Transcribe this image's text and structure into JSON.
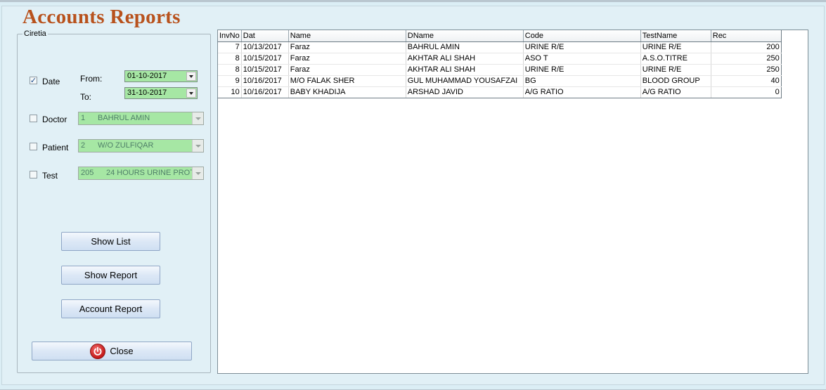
{
  "window": {
    "title": "Accounts Reports"
  },
  "criteria": {
    "legend": "Ciretia",
    "date": {
      "checked": true,
      "label": "Date",
      "from_label": "From:",
      "from_value": "01-10-2017",
      "to_label": "To:",
      "to_value": "31-10-2017"
    },
    "doctor": {
      "checked": false,
      "label": "Doctor",
      "code": "1",
      "value": "BAHRUL AMIN"
    },
    "patient": {
      "checked": false,
      "label": "Patient",
      "code": "2",
      "value": "W/O ZULFIQAR"
    },
    "test": {
      "checked": false,
      "label": "Test",
      "code": "205",
      "value": "24 HOURS URINE PROT"
    }
  },
  "buttons": {
    "show_list": "Show List",
    "show_report": "Show Report",
    "account_report": "Account Report",
    "close": "Close"
  },
  "grid": {
    "columns": [
      "InvNo",
      "Dat",
      "Name",
      "DName",
      "Code",
      "TestName",
      "Rec"
    ],
    "rows": [
      [
        "7",
        "10/13/2017",
        "Faraz",
        "BAHRUL AMIN",
        "URINE R/E",
        "URINE R/E",
        "200"
      ],
      [
        "8",
        "10/15/2017",
        "Faraz",
        "AKHTAR ALI SHAH",
        "ASO T",
        "A.S.O.TITRE",
        "250"
      ],
      [
        "8",
        "10/15/2017",
        "Faraz",
        "AKHTAR ALI SHAH",
        "URINE R/E",
        "URINE R/E",
        "250"
      ],
      [
        "9",
        "10/16/2017",
        "M/O FALAK SHER",
        "GUL MUHAMMAD YOUSAFZAI",
        "BG",
        "BLOOD GROUP",
        "40"
      ],
      [
        "10",
        "10/16/2017",
        "BABY KHADIJA",
        "ARSHAD JAVID",
        "A/G RATIO",
        "A/G RATIO",
        "0"
      ]
    ]
  },
  "colors": {
    "title": "#b8521d",
    "background": "#e1f0f6",
    "field_green": "#a6e7a4",
    "close_icon": "#c51a1a"
  },
  "icons": {
    "close": "power-icon",
    "dropdown": "chevron-down-icon",
    "check": "check-icon"
  }
}
